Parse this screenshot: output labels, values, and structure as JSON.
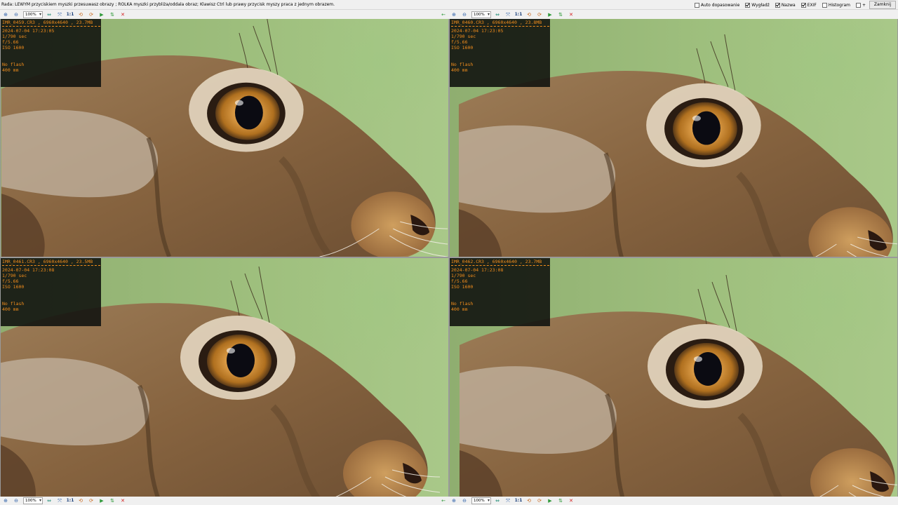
{
  "hint": "Rada: LEWYM przyciskiem myszki przesuwasz obrazy ; ROLKA myszki przybliża/oddala obraz; Klawisz Ctrl lub prawy przycisk myszy praca z jednym obrazem.",
  "options": [
    {
      "label": "Auto dopasowanie",
      "checked": false
    },
    {
      "label": "Wygładź",
      "checked": true
    },
    {
      "label": "Nazwa",
      "checked": true
    },
    {
      "label": "EXIF",
      "checked": true
    },
    {
      "label": "Histogram",
      "checked": false
    },
    {
      "label": "+",
      "checked": false
    }
  ],
  "close_label": "Zamknij",
  "toolbar": {
    "zoom_in_glyph": "⊕",
    "zoom_out_glyph": "⊖",
    "zoom_value": "100%",
    "fit_glyph": "⇔",
    "fit_all_glyph": "⤧",
    "ratio_label": "1:1",
    "rotate_left_glyph": "⟲",
    "rotate_right_glyph": "⟳",
    "next_glyph": "▶",
    "prev_glyph": "◀",
    "flip_glyph": "⇅",
    "back_glyph": "←",
    "close_glyph": "✕"
  },
  "images": [
    {
      "name": "IMR_0459.CR3 , 6960x4640 , 23.7MB",
      "datetime": "2024-07-04 17:23:05",
      "shutter": "1/790 sec",
      "aperture": "f/5.66",
      "iso": "ISO 1600",
      "flash": "No flash",
      "focal": "400 mm"
    },
    {
      "name": "IMR_0460.CR3 , 6960x4640 , 23.8MB",
      "datetime": "2024-07-04 17:23:05",
      "shutter": "1/790 sec",
      "aperture": "f/5.66",
      "iso": "ISO 1600",
      "flash": "No flash",
      "focal": "400 mm"
    },
    {
      "name": "IMR_0461.CR3 , 6960x4640 , 23.5MB",
      "datetime": "2024-07-04 17:23:08",
      "shutter": "1/790 sec",
      "aperture": "f/5.66",
      "iso": "ISO 1600",
      "flash": "No flash",
      "focal": "400 mm"
    },
    {
      "name": "IMR_0462.CR3 , 6960x4640 , 23.7MB",
      "datetime": "2024-07-04 17:23:08",
      "shutter": "1/790 sec",
      "aperture": "f/5.66",
      "iso": "ISO 1600",
      "flash": "No flash",
      "focal": "400 mm"
    }
  ],
  "colors": {
    "exif_text": "#f08c1c",
    "background_green": "#9fc07e",
    "fur": "#8a6a47"
  }
}
